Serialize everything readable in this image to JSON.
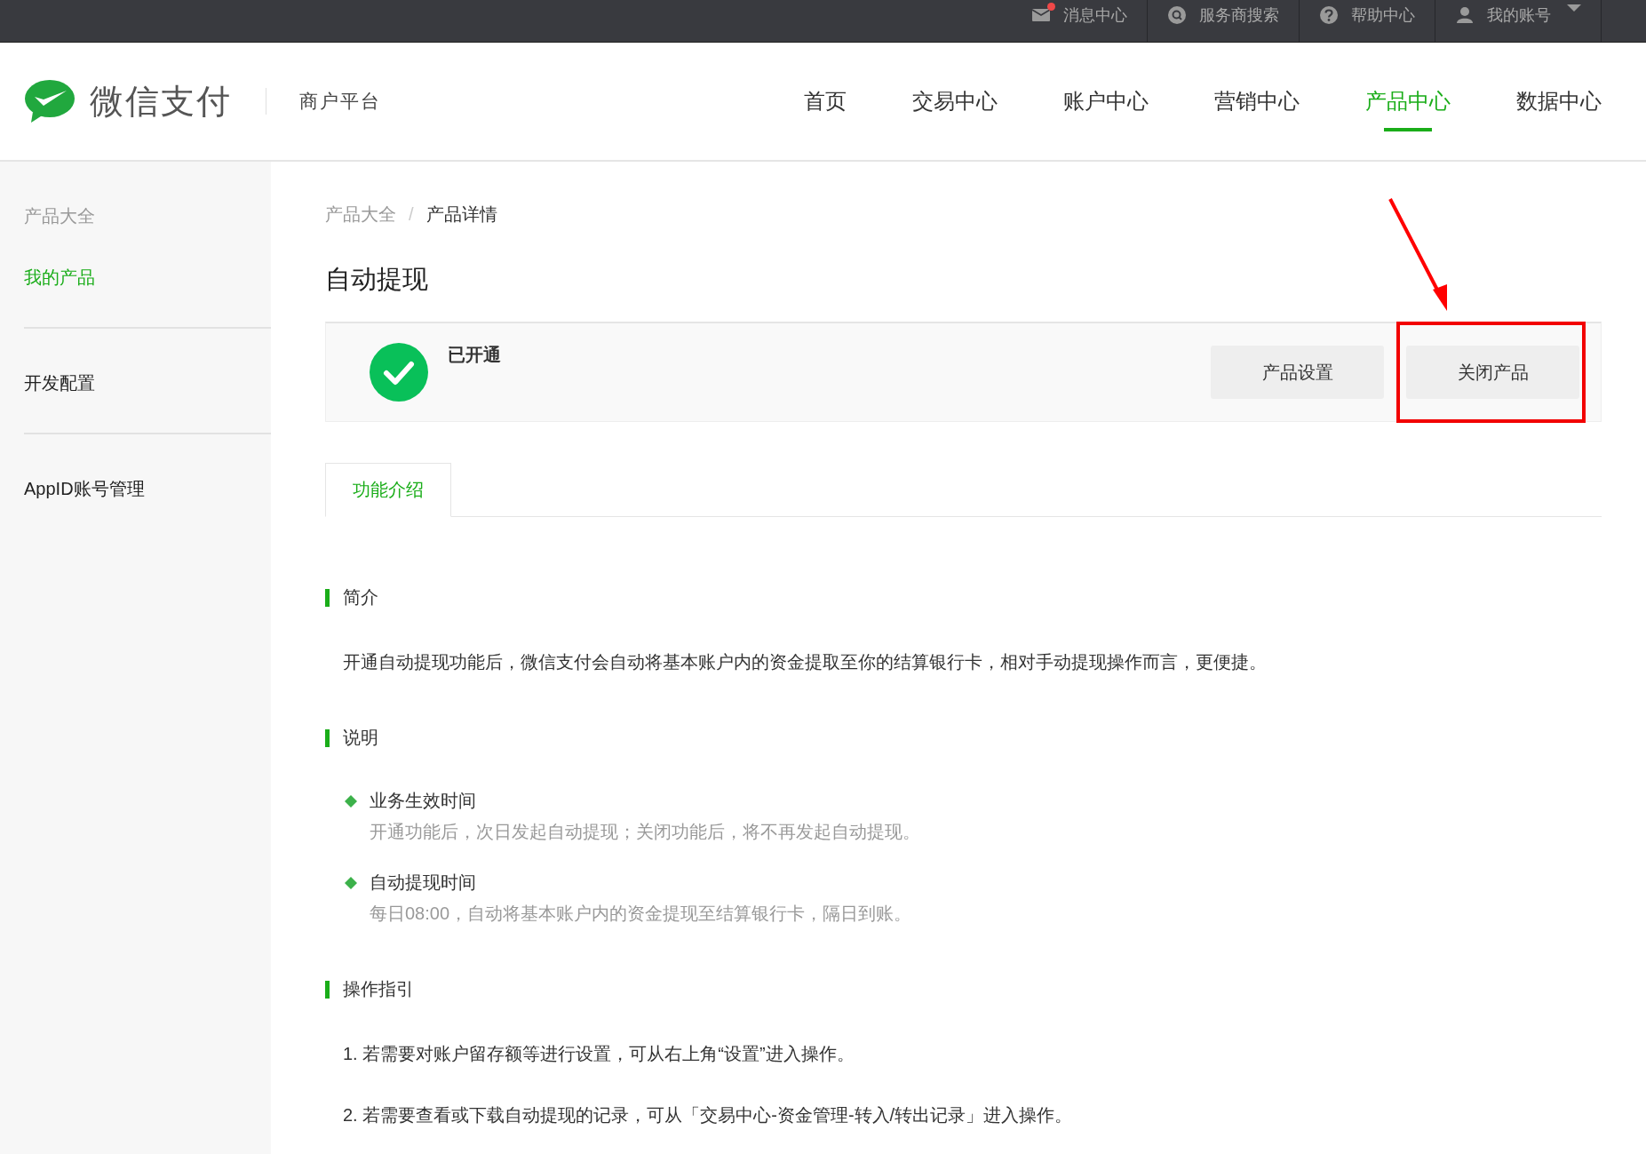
{
  "top_bar": {
    "items": [
      {
        "label": "消息中心",
        "unread": true,
        "dropdown": false
      },
      {
        "label": "服务商搜索",
        "unread": false,
        "dropdown": false
      },
      {
        "label": "帮助中心",
        "unread": false,
        "dropdown": false
      },
      {
        "label": "我的账号",
        "unread": false,
        "dropdown": true
      }
    ]
  },
  "header": {
    "logo_text": "微信支付",
    "platform": "商户平台",
    "nav": [
      {
        "label": "首页",
        "selected": false
      },
      {
        "label": "交易中心",
        "selected": false
      },
      {
        "label": "账户中心",
        "selected": false
      },
      {
        "label": "营销中心",
        "selected": false
      },
      {
        "label": "产品中心",
        "selected": true
      },
      {
        "label": "数据中心",
        "selected": false
      }
    ]
  },
  "sidebar": {
    "groups": [
      {
        "items": [
          {
            "label": "产品大全",
            "selected": false
          },
          {
            "label": "我的产品",
            "selected": true
          }
        ]
      },
      {
        "items": [
          {
            "label": "开发配置",
            "selected": false
          }
        ]
      },
      {
        "items": [
          {
            "label": "AppID账号管理",
            "selected": false
          }
        ]
      }
    ]
  },
  "breadcrumb": {
    "items": [
      "产品大全",
      "产品详情"
    ],
    "separator": "/"
  },
  "title": "自动提现",
  "status_card": {
    "status": "已开通",
    "opened": true,
    "buttons": [
      {
        "label": "产品设置",
        "annotated": false
      },
      {
        "label": "关闭产品",
        "annotated": true
      }
    ]
  },
  "tabs": [
    {
      "label": "功能介绍",
      "selected": true
    }
  ],
  "sections": [
    {
      "heading": "简介",
      "kind": "paragraph",
      "text": "开通自动提现功能后，微信支付会自动将基本账户内的资金提取至你的结算银行卡，相对手动提现操作而言，更便捷。"
    },
    {
      "heading": "说明",
      "kind": "bullets",
      "items": [
        {
          "title": "业务生效时间",
          "text": "开通功能后，次日发起自动提现；关闭功能后，将不再发起自动提现。"
        },
        {
          "title": "自动提现时间",
          "text": "每日08:00，自动将基本账户内的资金提现至结算银行卡，隔日到账。"
        }
      ]
    },
    {
      "heading": "操作指引",
      "kind": "steps",
      "items": [
        "1. 若需要对账户留存额等进行设置，可从右上角“设置”进入操作。",
        "2. 若需要查看或下载自动提现的记录，可从「交易中心-资金管理-转入/转出记录」进入操作。"
      ]
    }
  ]
}
